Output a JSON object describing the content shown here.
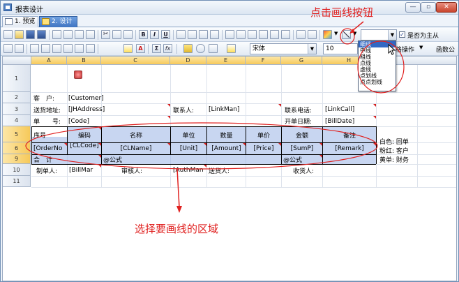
{
  "window": {
    "title": "报表设计",
    "min_glyph": "—",
    "max_glyph": "▫",
    "close_glyph": "✕"
  },
  "tabs": [
    {
      "label": "1. 预览"
    },
    {
      "label": "2. 设计"
    }
  ],
  "toolbar": {
    "line_combo_value": "",
    "main_checkbox_label": "是否为主从",
    "main_checkbox_mark": "✓",
    "font_name": "宋体",
    "font_size": "10",
    "partial_label_1": "格操作",
    "partial_label_2": "函数公",
    "bold": "B",
    "italic": "I",
    "underline": "U",
    "sigma": "Σ",
    "fx": "fx",
    "font_color": "A",
    "dropdown_arrow": "▼"
  },
  "line_menu": {
    "items": [
      "细线",
      "中线",
      "粗线",
      "点线",
      "虚线",
      "点划线",
      "点点划线"
    ],
    "selected_index": 0
  },
  "sheet": {
    "columns": [
      "A",
      "B",
      "C",
      "D",
      "E",
      "F",
      "G",
      "H"
    ],
    "rows": [
      "1",
      "2",
      "3",
      "4",
      "5",
      "6",
      "9",
      "10",
      "11"
    ],
    "cells": {
      "r2_label": "客　户:",
      "r2_value": "[Customer]",
      "r3_label": "送货地址:",
      "r3_value": "[JHAddress]",
      "r3_contact_label": "联系人:",
      "r3_contact_value": "[LinkMan]",
      "r3_phone_label": "联系电话:",
      "r3_phone_value": "[LinkCall]",
      "r4_label": "单　　号:",
      "r4_value": "[Code]",
      "r4_date_label": "开单日期:",
      "r4_date_value": "[BillDate]",
      "r5_headers": [
        "序号",
        "编码",
        "名称",
        "单位",
        "数量",
        "单价",
        "金额",
        "备注"
      ],
      "r6_values": [
        "[OrderNo",
        "[CLCode]",
        "[CLName]",
        "[Unit]",
        "[Amount]",
        "[Price]",
        "[SumP]",
        "[Remark]"
      ],
      "r9_total": "合　计",
      "r9_formula_1": "@公式",
      "r9_formula_2": "@公式",
      "r10_maker": "制单人:",
      "r10_maker_value": "[BillMar",
      "r10_checker": "审核人:",
      "r10_auth": "[AuthMan",
      "r10_sender": "送货人:",
      "r10_receiver": "收货人:",
      "side_note_1": "白色: 回单",
      "side_note_2": "粉红: 客户",
      "side_note_3": "黄单: 财务"
    }
  },
  "annotations": {
    "click_line_button": "点击画线按钮",
    "select_area": "选择要画线的区域"
  },
  "colors": {
    "annotation": "#e0201f",
    "selection": "#9bb4e6",
    "menu_highlight": "#3168c4"
  }
}
